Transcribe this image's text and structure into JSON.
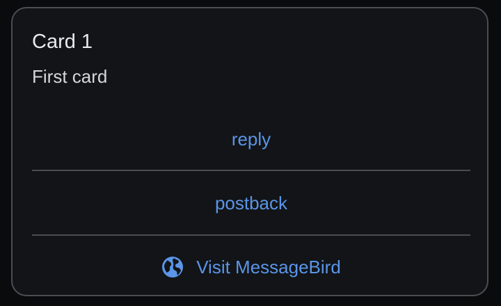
{
  "card": {
    "title": "Card 1",
    "description": "First card",
    "actions": [
      {
        "label": "reply",
        "icon": null
      },
      {
        "label": "postback",
        "icon": null
      },
      {
        "label": "Visit MessageBird",
        "icon": "globe-icon"
      }
    ]
  },
  "colors": {
    "background": "#0a0b0d",
    "card_background": "#121417",
    "border": "#4a4e52",
    "title": "#e8eaed",
    "description": "#d4d7db",
    "accent": "#5b95e8"
  }
}
